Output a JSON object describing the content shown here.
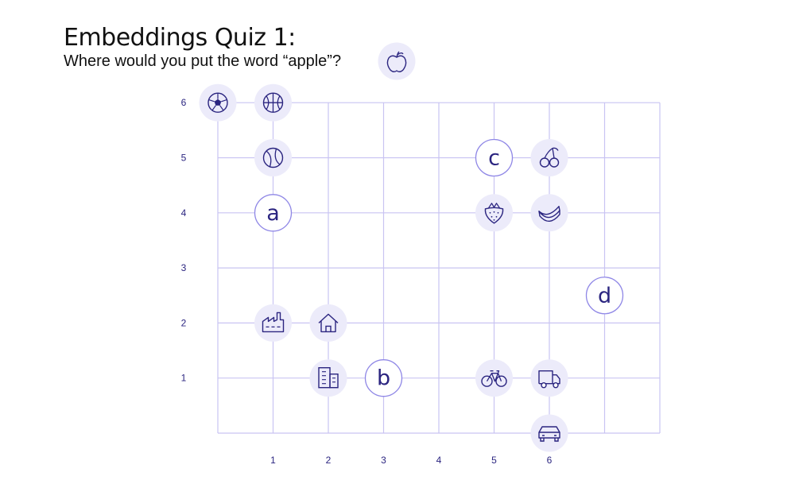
{
  "header": {
    "title": "Embeddings Quiz 1:",
    "question": "Where would you put the word “apple”?",
    "query_icon": "apple-icon"
  },
  "colors": {
    "grid": "#c9c4f2",
    "circle_fill": "#ecebfa",
    "circle_stroke": "#8f87e6",
    "ink": "#2b2580"
  },
  "axes": {
    "x_ticks": [
      "1",
      "2",
      "3",
      "4",
      "5",
      "6"
    ],
    "y_ticks": [
      "1",
      "2",
      "3",
      "4",
      "5",
      "6"
    ]
  },
  "chart_data": {
    "type": "scatter",
    "xlim": [
      0,
      8
    ],
    "ylim": [
      0,
      6
    ],
    "grid": true,
    "points": [
      {
        "kind": "icon",
        "icon": "soccer-ball-icon",
        "x": 0,
        "y": 6
      },
      {
        "kind": "icon",
        "icon": "basketball-icon",
        "x": 1,
        "y": 6
      },
      {
        "kind": "icon",
        "icon": "tennis-ball-icon",
        "x": 1,
        "y": 5
      },
      {
        "kind": "option",
        "label": "a",
        "x": 1,
        "y": 4
      },
      {
        "kind": "icon",
        "icon": "factory-icon",
        "x": 1,
        "y": 2
      },
      {
        "kind": "icon",
        "icon": "house-icon",
        "x": 2,
        "y": 2
      },
      {
        "kind": "icon",
        "icon": "building-icon",
        "x": 2,
        "y": 1
      },
      {
        "kind": "option",
        "label": "b",
        "x": 3,
        "y": 1
      },
      {
        "kind": "option",
        "label": "c",
        "x": 5,
        "y": 5
      },
      {
        "kind": "icon",
        "icon": "cherries-icon",
        "x": 6,
        "y": 5
      },
      {
        "kind": "icon",
        "icon": "strawberry-icon",
        "x": 5,
        "y": 4
      },
      {
        "kind": "icon",
        "icon": "banana-icon",
        "x": 6,
        "y": 4
      },
      {
        "kind": "option",
        "label": "d",
        "x": 7,
        "y": 2.5
      },
      {
        "kind": "icon",
        "icon": "bicycle-icon",
        "x": 5,
        "y": 1
      },
      {
        "kind": "icon",
        "icon": "truck-icon",
        "x": 6,
        "y": 1
      },
      {
        "kind": "icon",
        "icon": "car-icon",
        "x": 6,
        "y": 0
      }
    ]
  }
}
